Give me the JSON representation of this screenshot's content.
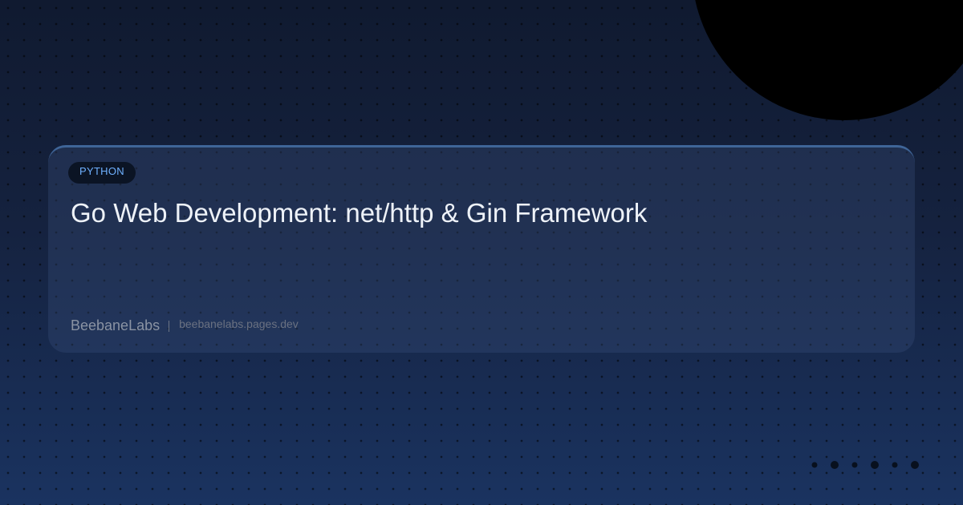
{
  "card": {
    "badge": "PYTHON",
    "title": "Go Web Development: net/http & Gin Framework",
    "brand": "BeebaneLabs",
    "domain": "beebanelabs.pages.dev"
  },
  "colors": {
    "background_top": "#101a30",
    "background_bottom": "#1a3360",
    "accent": "#6fb1ff",
    "card_border": "#3f6598"
  },
  "pager": {
    "dot_count": 6
  }
}
